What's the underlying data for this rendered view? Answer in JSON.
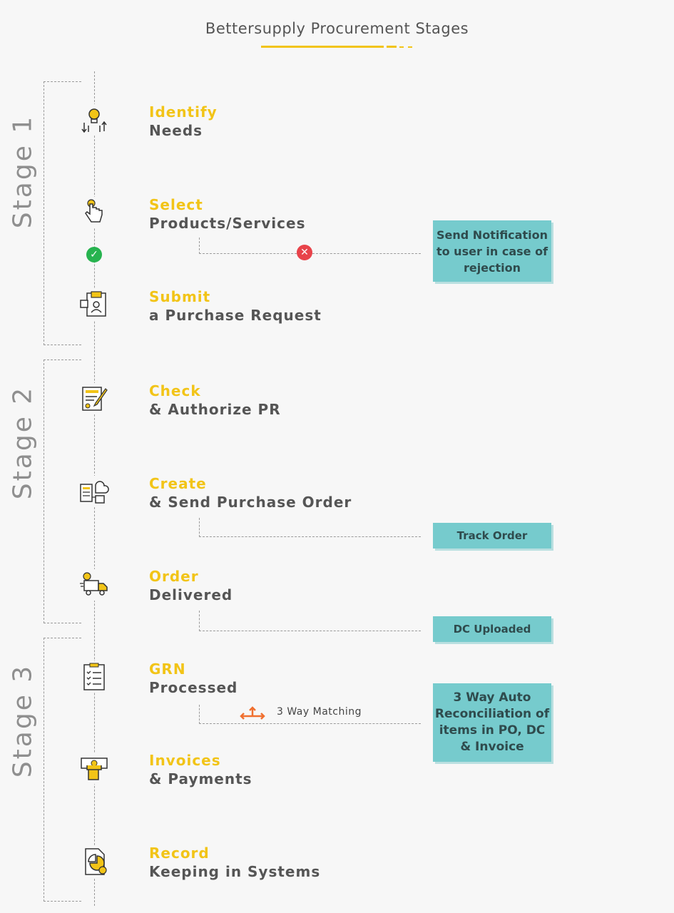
{
  "title": "Bettersupply Procurement Stages",
  "stages": [
    {
      "label": "Stage 1"
    },
    {
      "label": "Stage 2"
    },
    {
      "label": "Stage 3"
    }
  ],
  "steps": [
    {
      "head": "Identify",
      "sub": "Needs",
      "icon": "idea-bulb-icon"
    },
    {
      "head": "Select",
      "sub": "Products/Services",
      "icon": "hand-pointer-icon"
    },
    {
      "head": "Submit",
      "sub": "a Purchase Request",
      "icon": "request-form-icon"
    },
    {
      "head": "Check",
      "sub": "& Authorize PR",
      "icon": "document-sign-icon"
    },
    {
      "head": "Create",
      "sub": "& Send Purchase Order",
      "icon": "cloud-order-icon"
    },
    {
      "head": "Order",
      "sub": "Delivered",
      "icon": "delivery-truck-icon"
    },
    {
      "head": "GRN",
      "sub": "Processed",
      "icon": "checklist-icon"
    },
    {
      "head": "Invoices",
      "sub": "& Payments",
      "icon": "payment-hand-icon"
    },
    {
      "head": "Record",
      "sub": "Keeping in Systems",
      "icon": "report-chart-icon"
    }
  ],
  "notes": {
    "rejection": "Send Notification to user in case of rejection",
    "track": "Track Order",
    "dc": "DC Uploaded",
    "reconcile": "3 Way Auto Reconciliation of items in PO, DC & Invoice"
  },
  "matching_label": "3 Way Matching",
  "colors": {
    "accent": "#f2c417",
    "note_bg": "#76cbcd",
    "reject": "#e8434a",
    "approve": "#27b34f",
    "text": "#555555"
  }
}
